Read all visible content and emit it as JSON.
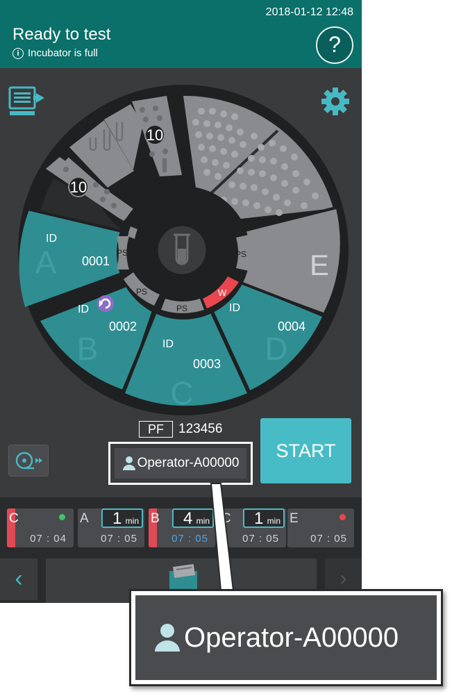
{
  "header": {
    "datetime": "2018-01-12   12:48",
    "title": "Ready to test",
    "subtitle": "Incubator is full",
    "help_label": "?"
  },
  "carousel": {
    "racks": [
      {
        "count": "10"
      },
      {
        "count": "10"
      }
    ],
    "cartridge_label": "PS",
    "warning_label": "W",
    "sectors": [
      {
        "letter": "A",
        "id_label": "ID",
        "sample": "0001"
      },
      {
        "letter": "B",
        "id_label": "ID",
        "sample": "0002"
      },
      {
        "letter": "C",
        "id_label": "ID",
        "sample": "0003"
      },
      {
        "letter": "D",
        "id_label": "ID",
        "sample": "0004"
      },
      {
        "letter": "E"
      }
    ]
  },
  "pf": {
    "label": "PF",
    "value": "123456"
  },
  "operator": {
    "name": "Operator-A00000"
  },
  "start_label": "START",
  "slots": [
    {
      "letter": "C",
      "time": "07 : 04",
      "status_color": "#3ec46d"
    },
    {
      "letter": "A",
      "time": "07 : 05",
      "timer": "1",
      "unit": "min"
    },
    {
      "letter": "B",
      "time": "07 : 05",
      "timer": "4",
      "unit": "min"
    },
    {
      "letter": "C",
      "time": "07 : 05",
      "timer": "1",
      "unit": "min"
    },
    {
      "letter": "E",
      "time": "07 : 05",
      "status_color": "#e8474f"
    }
  ],
  "nav": {
    "back": "‹",
    "forward": "›"
  },
  "zoom": {
    "operator_name": "Operator-A00000"
  },
  "colors": {
    "teal": "#2f8e92",
    "header": "#0b6f6a",
    "start": "#48bcc6",
    "warning": "#e8474f"
  },
  "icons": [
    "queue-icon",
    "gear-icon",
    "test-tube-icon",
    "refresh-icon",
    "eject-icon",
    "user-icon",
    "folder-icon"
  ]
}
